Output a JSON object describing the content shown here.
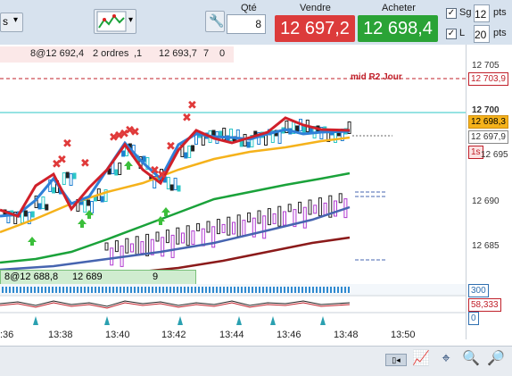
{
  "toolbar": {
    "dropdown_label": "s",
    "qty_label": "Qté",
    "qty_value": "8",
    "sell_label": "Vendre",
    "sell_price": "12 697,2",
    "buy_label": "Acheter",
    "buy_price": "12 698,4",
    "sg_label": "Sg",
    "sg_value": "12",
    "sg_unit": "pts",
    "l_label": "L",
    "l_value": "20",
    "l_unit": "pts"
  },
  "orders": {
    "pending": "8@12 692,4",
    "count": "2 ordres",
    "frag1": ",1",
    "order_price": "12 693,7",
    "frag2": "7",
    "frag3": "0"
  },
  "annotations": {
    "level_label": "mid R2 Jour",
    "position_label": "8@12 688,8",
    "position_label2": "12 689",
    "position_frag": "9"
  },
  "yaxis": {
    "ticks": [
      "12 705",
      "12 700",
      "12 695",
      "12 690",
      "12 685"
    ],
    "tag_r2": "12 703,9",
    "tag_ask": "12 698,3",
    "tag_bid": "12 697,9",
    "tag_time": "1s",
    "ind1": "300",
    "ind2": "58,333",
    "ind3": "0"
  },
  "xaxis": {
    "ticks": [
      ":36",
      "13:38",
      "13:40",
      "13:42",
      "13:44",
      "13:46",
      "13:48",
      "13:50"
    ]
  },
  "colors": {
    "sell": "#dc3b3b",
    "buy": "#2aa336",
    "ma_orange": "#f5b21b",
    "ma_green": "#1aa23a",
    "ma_blue": "#4664b0",
    "ma_darkred": "#8b1a1a"
  },
  "icons": [
    "wrench-icon",
    "chart-type-icon",
    "zoom-in-icon",
    "zoom-out-icon",
    "zoom-fit-icon",
    "crosshair-icon"
  ]
}
